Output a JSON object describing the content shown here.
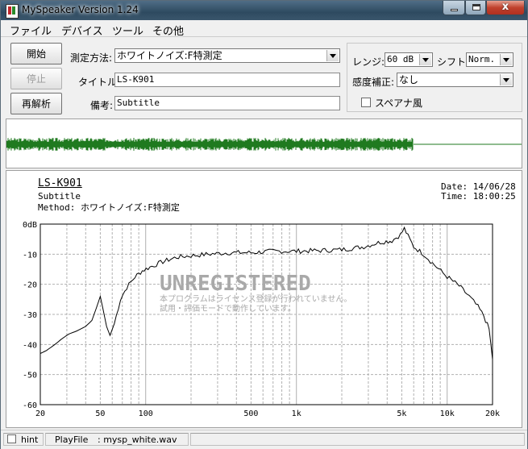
{
  "window": {
    "title": "MySpeaker Version 1.24",
    "close_glyph": "x"
  },
  "menu": [
    "ファイル",
    "デバイス",
    "ツール",
    "その他"
  ],
  "buttons": {
    "start": "開始",
    "stop": "停止",
    "reanalyze": "再解析"
  },
  "form": {
    "method_label": "測定方法:",
    "method_value": "ホワイトノイズ:F特測定",
    "title_label": "タイトル:",
    "title_value": "LS-K901",
    "note_label": "備考:",
    "note_value": "Subtitle"
  },
  "settings": {
    "range_label": "レンジ:",
    "range_value": "60 dB",
    "shift_label": "シフト:",
    "shift_value": "Norm.",
    "sens_label": "感度補正:",
    "sens_value": "なし",
    "spectrum_label": "スペアナ風",
    "spectrum_checked": false
  },
  "graph": {
    "title": "LS-K901",
    "subtitle": "Subtitle",
    "method_line": "Method:  ホワイトノイズ:F特測定",
    "date_line": "Date: 14/06/28",
    "time_line": "Time: 18:00:25",
    "watermark": "UNREGISTERED",
    "watermark_sub1": "本プログラムはライセンス登録が行われていません。",
    "watermark_sub2": "試用・評価モードで動作しています。",
    "y_ticks": [
      "0dB",
      "-10",
      "-20",
      "-30",
      "-40",
      "-50",
      "-60"
    ],
    "x_ticks": [
      "20",
      "50",
      "100",
      "500",
      "1k",
      "5k",
      "10k",
      "20k"
    ]
  },
  "status": {
    "hint_label": "hint",
    "play_label": "PlayFile",
    "play_value": ": mysp_white.wav",
    "hint_checked": false
  },
  "colors": {
    "wave": "#1f7a1f",
    "curve": "#000000",
    "grid": "#b0b0b0",
    "watermark": "#a9a9a9"
  },
  "chart_data": {
    "type": "line",
    "title": "LS-K901",
    "xlabel": "",
    "ylabel": "",
    "x_scale": "log",
    "xlim": [
      20,
      20000
    ],
    "ylim": [
      -60,
      0
    ],
    "grid": true,
    "series": [
      {
        "x": [
          20,
          22,
          25,
          28,
          31,
          35,
          40,
          44,
          47,
          50,
          52,
          55,
          58,
          62,
          68,
          75,
          85,
          95,
          110,
          130,
          160,
          200,
          260,
          350,
          500,
          700,
          1000,
          1400,
          2000,
          2800,
          3600,
          4300,
          4900,
          5200,
          5500,
          6000,
          7000,
          8000,
          10000,
          12000,
          14000,
          16000,
          17500,
          19000,
          20000
        ],
        "y": [
          -43,
          -42,
          -40,
          -38,
          -36.5,
          -35.5,
          -34,
          -32,
          -28,
          -24,
          -28,
          -34,
          -37,
          -33,
          -25,
          -21,
          -17.5,
          -15.5,
          -14,
          -12.5,
          -11,
          -10.5,
          -10,
          -9.5,
          -9.5,
          -9,
          -9,
          -8.8,
          -8.5,
          -7.5,
          -6,
          -5.5,
          -3.5,
          -1.5,
          -4,
          -7.5,
          -10,
          -13,
          -17.5,
          -20.5,
          -24,
          -27.5,
          -30.5,
          -35,
          -45
        ]
      }
    ]
  }
}
